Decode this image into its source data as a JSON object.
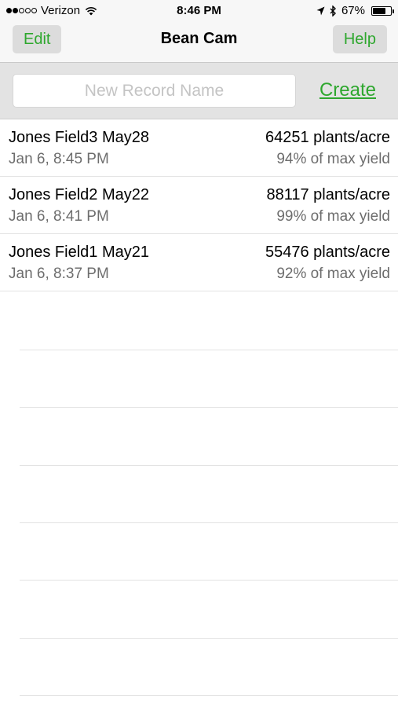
{
  "status_bar": {
    "carrier": "Verizon",
    "time": "8:46 PM",
    "battery": "67%"
  },
  "nav": {
    "edit_label": "Edit",
    "title": "Bean Cam",
    "help_label": "Help"
  },
  "create": {
    "placeholder": "New Record Name",
    "value": "",
    "create_label": "Create"
  },
  "records": [
    {
      "name": "Jones Field3 May28",
      "date": "Jan 6, 8:45 PM",
      "density": "64251 plants/acre",
      "yield": "94% of max yield"
    },
    {
      "name": "Jones Field2 May22",
      "date": "Jan 6, 8:41 PM",
      "density": "88117 plants/acre",
      "yield": "99% of max yield"
    },
    {
      "name": "Jones Field1 May21",
      "date": "Jan 6, 8:37 PM",
      "density": "55476 plants/acre",
      "yield": "92% of max yield"
    }
  ],
  "colors": {
    "accent": "#2ea72e",
    "bar_background": "#f7f7f7",
    "secondary_text": "#6d6d6d"
  },
  "icons": [
    "signal-dots-icon",
    "wifi-icon",
    "location-arrow-icon",
    "bluetooth-icon",
    "battery-icon"
  ]
}
